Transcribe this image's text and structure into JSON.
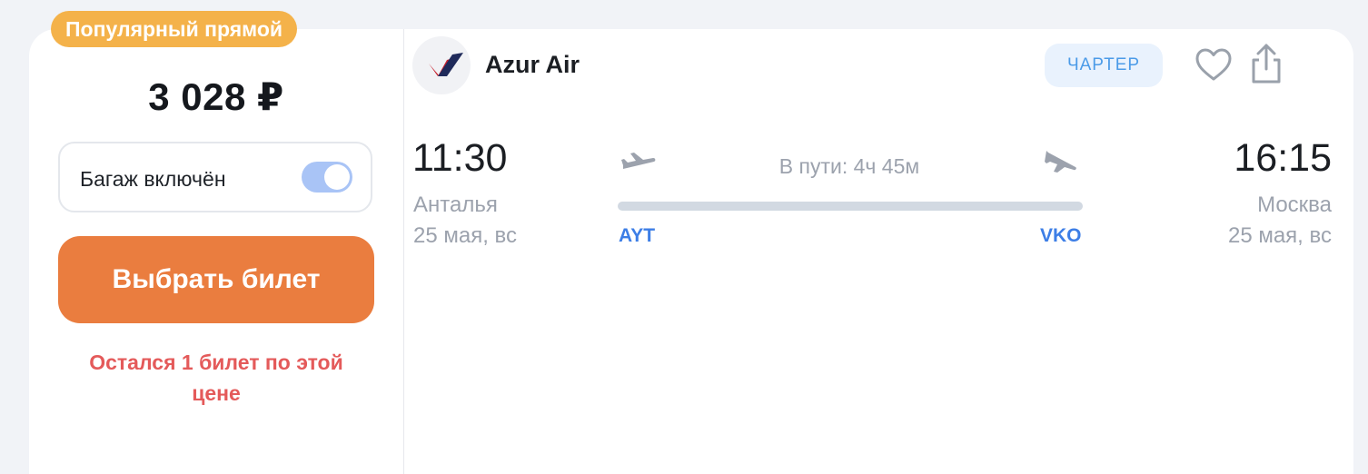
{
  "offer": {
    "badge": "Популярный прямой",
    "price": "3 028 ₽",
    "baggage_label": "Багаж включён",
    "baggage_included": true,
    "select_button": "Выбрать билет",
    "tickets_left": "Остался 1 билет по этой цене"
  },
  "airline": {
    "name": "Azur Air",
    "logo_icon": "azur-air-logo",
    "charter_label": "ЧАРТЕР"
  },
  "flight": {
    "departure": {
      "time": "11:30",
      "city": "Анталья",
      "date": "25 мая, вс",
      "code": "AYT"
    },
    "arrival": {
      "time": "16:15",
      "city": "Москва",
      "date": "25 мая, вс",
      "code": "VKO"
    },
    "duration": "В пути: 4ч 45м"
  },
  "colors": {
    "badge": "#f4b24a",
    "button": "#ea7d3f",
    "warning": "#e45a5a",
    "code": "#3d7ee6",
    "toggle": "#a9c4f6"
  }
}
